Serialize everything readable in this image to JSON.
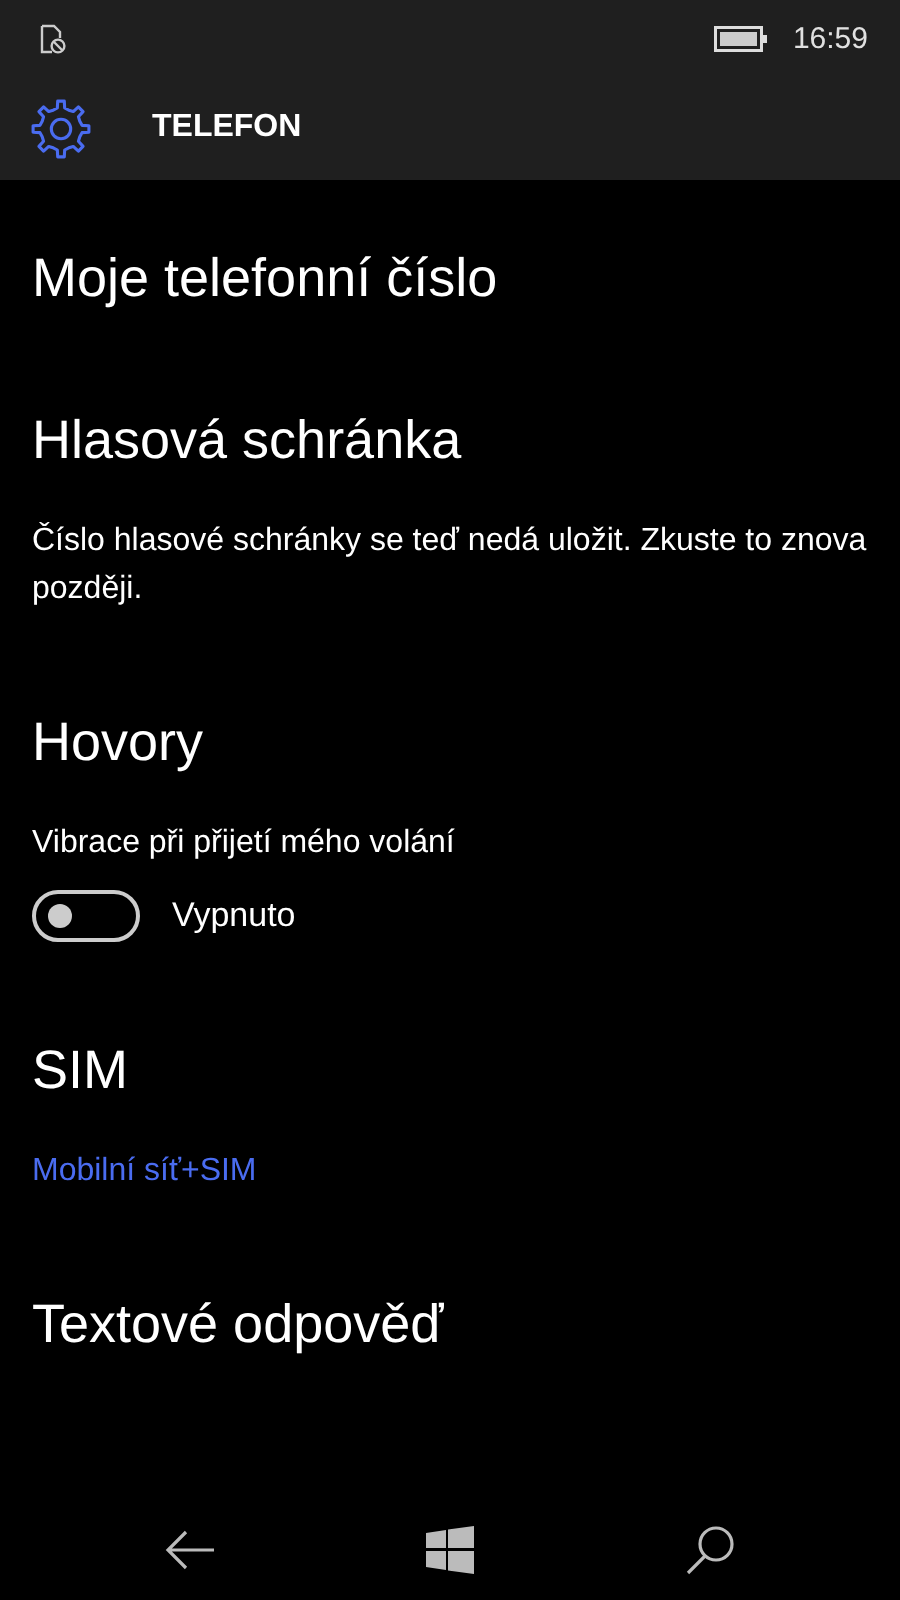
{
  "status_bar": {
    "time": "16:59"
  },
  "header": {
    "title": "TELEFON"
  },
  "sections": [
    {
      "title": "Moje telefonní číslo"
    },
    {
      "title": "Hlasová schránka",
      "items": [
        {
          "kind": "text",
          "text": "Číslo hlasové schránky se teď nedá uložit. Zkuste to znova později."
        }
      ]
    },
    {
      "title": "Hovory",
      "items": [
        {
          "kind": "toggle",
          "label": "Vibrace při přijetí mého volání",
          "on": false,
          "state_text": "Vypnuto"
        }
      ]
    },
    {
      "title": "SIM",
      "items": [
        {
          "kind": "link",
          "text": "Mobilní síť+SIM"
        }
      ]
    },
    {
      "title": "Textové odpověď"
    }
  ]
}
